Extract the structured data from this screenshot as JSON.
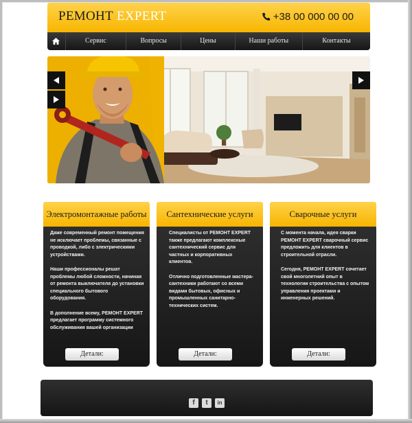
{
  "header": {
    "logo_part1": "РЕМОНТ",
    "logo_part2": "EXPERT",
    "phone": "+38 00 000 00 00"
  },
  "nav": {
    "items": [
      "Сервис",
      "Вопросы",
      "Цены",
      "Наши работы",
      "Контакты"
    ]
  },
  "services": [
    {
      "title": "Электромонтажные работы",
      "paragraphs": [
        "Даже современный ремонт помещения не исключает проблемы, связанные с проводкой, либо с электрическими устройствами.",
        "Наши профессионалы решат проблемы любой сложности, начиная от ремонта выключателя до установки специального бытового оборудования.",
        "В дополнение всему, РЕМОНТ EXPERT предлагает программу системного обслуживания вашей организации"
      ],
      "button": "Детали:"
    },
    {
      "title": "Сантехнические услуги",
      "paragraphs": [
        "Специалисты от РЕМОНТ EXPERT также предлагают комплексные сантехнический сервис для частных и корпоративных клиентов.",
        "Отлично подготовленные мастера-сантехники работают со всеми видами бытовых, офисных и промышленных санитарно-технических систем."
      ],
      "button": "Детали:"
    },
    {
      "title": "Сварочные услуги",
      "paragraphs": [
        "С момента начала, идея сварки РЕМОНТ EXPERT сварочный сервис предложить для клиентов в строительной отрасли.",
        "Сегодня, РЕМОНТ EXPERT сочетает свой многолетний опыт в технологии строительства с опытом управления проектами и инженерных решений."
      ],
      "button": "Детали:"
    }
  ],
  "footer": {
    "social": [
      "f",
      "t",
      "in"
    ]
  },
  "colors": {
    "accent": "#f7b500",
    "dark": "#1a1a1a"
  }
}
